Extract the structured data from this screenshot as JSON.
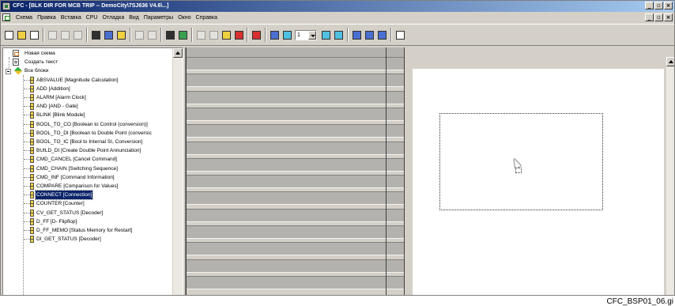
{
  "window": {
    "title": "CFC - [BLK DIR FOR MCB TRIP -- DemoCity\\7SJ636 V4.6\\...]",
    "min_label": "_",
    "restore_label": "ð",
    "close_label": "×"
  },
  "menu": {
    "items": [
      "Схема",
      "Правка",
      "Вставка",
      "CPU",
      "Отладка",
      "Вид",
      "Параметры",
      "Окно",
      "Справка"
    ]
  },
  "toolbar": {
    "level_value": "1",
    "buttons": [
      "new-icon",
      "open-icon",
      "print-icon",
      "cut-icon",
      "copy-icon",
      "paste-icon",
      "sheet-view-icon",
      "overview-icon",
      "chart-icon",
      "prev-sheet-icon",
      "next-sheet-icon",
      "block-icon",
      "catalog-icon",
      "undo-icon",
      "redo-icon",
      "run-icon",
      "stop-icon",
      "test-icon",
      "compile-icon",
      "grid-icon",
      "toggle-icon",
      "zoom-in-icon",
      "zoom-out-icon",
      "window-icon",
      "split-icon",
      "panel-icon",
      "help-icon"
    ]
  },
  "tree": {
    "items": [
      {
        "label": "Новая схема",
        "type": "new",
        "level": 1
      },
      {
        "label": "Создать текст",
        "type": "txt",
        "level": 1
      },
      {
        "label": "Все блоки",
        "type": "lib",
        "level": 1
      },
      {
        "label": "ABSVALUE [Magnitude Calculation]",
        "type": "blk",
        "level": 2
      },
      {
        "label": "ADD [Addition]",
        "type": "blk",
        "level": 2
      },
      {
        "label": "ALARM [Alarm Clock]",
        "type": "blk",
        "level": 2
      },
      {
        "label": "AND [AND - Gate]",
        "type": "blk",
        "level": 2
      },
      {
        "label": "BLINK [Blink Module]",
        "type": "blk",
        "level": 2
      },
      {
        "label": "BOOL_TO_CO [Boolean to Control (conversion)]",
        "type": "blk",
        "level": 2
      },
      {
        "label": "BOOL_TO_DI [Boolean to Double Point (conversic",
        "type": "blk",
        "level": 2
      },
      {
        "label": "BOOL_TO_IC [Bool to Internal SI, Conversion]",
        "type": "blk",
        "level": 2
      },
      {
        "label": "BUILD_DI [Create Double Point Annunciation]",
        "type": "blk",
        "level": 2
      },
      {
        "label": "CMD_CANCEL [Cancel Command]",
        "type": "blk",
        "level": 2
      },
      {
        "label": "CMD_CHAIN [Switching Sequence]",
        "type": "blk",
        "level": 2
      },
      {
        "label": "CMD_INF [Command Information]",
        "type": "blk",
        "level": 2
      },
      {
        "label": "COMPARE [Comparison for Values]",
        "type": "blk",
        "level": 2
      },
      {
        "label": "CONNECT [Connection]",
        "type": "blk",
        "level": 2,
        "selected": true
      },
      {
        "label": "COUNTER [Counter]",
        "type": "blk",
        "level": 2
      },
      {
        "label": "CV_GET_STATUS [Decoder]",
        "type": "blk",
        "level": 2
      },
      {
        "label": "D_FF [D- Flipflop]",
        "type": "blk",
        "level": 2
      },
      {
        "label": "D_FF_MEMO [Status Memory for Restart]",
        "type": "blk",
        "level": 2
      },
      {
        "label": "DI_GET_STATUS [Decoder]",
        "type": "blk",
        "level": 2
      }
    ]
  },
  "caption": "CFC_BSP01_06.gi"
}
